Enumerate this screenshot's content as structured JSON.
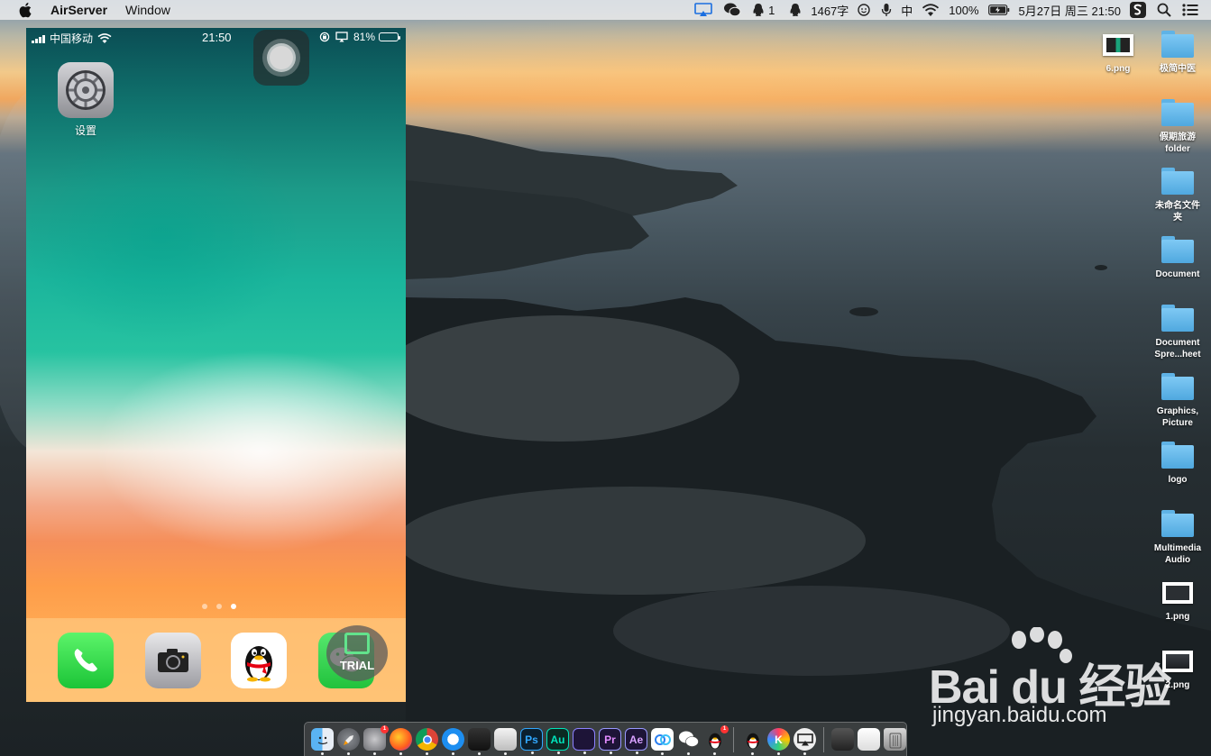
{
  "menubar": {
    "app_name": "AirServer",
    "menus": [
      "Window"
    ],
    "word_count": "1467字",
    "input_method": "中",
    "battery": "100%",
    "datetime": "5月27日 周三  21:50",
    "qq_count": "1"
  },
  "phone": {
    "status": {
      "carrier": "中国移动",
      "time": "21:50",
      "battery": "81%",
      "battery_level": 0.81
    },
    "home_apps": [
      {
        "label": "设置",
        "icon": "settings-gear-icon"
      }
    ],
    "page_count": 3,
    "active_page": 3,
    "dock_apps": [
      {
        "icon": "phone-icon"
      },
      {
        "icon": "camera-icon"
      },
      {
        "icon": "qq-penguin-icon"
      },
      {
        "icon": "wechat-icon"
      }
    ],
    "trial_label": "TRIAL"
  },
  "desktop": {
    "icons": [
      {
        "label": "6.png",
        "type": "image"
      },
      {
        "label": "极简中医",
        "type": "folder"
      },
      {
        "label": "假期旅游\nfolder",
        "type": "folder"
      },
      {
        "label": "未命名文件\n夹",
        "type": "folder"
      },
      {
        "label": "Document",
        "type": "folder"
      },
      {
        "label": "Document\nSpre...heet",
        "type": "folder"
      },
      {
        "label": "Graphics,\nPicture",
        "type": "folder"
      },
      {
        "label": "logo",
        "type": "folder"
      },
      {
        "label": "Multimedia\nAudio",
        "type": "folder"
      },
      {
        "label": "1.png",
        "type": "image"
      },
      {
        "label": "2.png",
        "type": "image"
      }
    ]
  },
  "dock": {
    "apps": [
      {
        "icon": "finder-icon",
        "text": ""
      },
      {
        "icon": "launchpad-rocket-icon",
        "text": ""
      },
      {
        "icon": "system-preferences-icon",
        "text": "",
        "badge": "1"
      },
      {
        "icon": "firefox-icon",
        "text": ""
      },
      {
        "icon": "chrome-icon",
        "text": ""
      },
      {
        "icon": "quicktime-icon",
        "text": ""
      },
      {
        "icon": "final-cut-icon",
        "text": ""
      },
      {
        "icon": "screenshot-icon",
        "text": ""
      },
      {
        "icon": "photoshop-icon",
        "text": "Ps"
      },
      {
        "icon": "audition-icon",
        "text": "Au"
      },
      {
        "icon": "media-encoder-icon",
        "text": ""
      },
      {
        "icon": "premiere-icon",
        "text": "Pr"
      },
      {
        "icon": "after-effects-icon",
        "text": "Ae"
      },
      {
        "icon": "baidu-netdisk-icon",
        "text": ""
      },
      {
        "icon": "wechat-dock-icon",
        "text": ""
      },
      {
        "icon": "qq-dock-icon",
        "text": "",
        "badge": "1"
      }
    ],
    "apps2": [
      {
        "icon": "qq-alt-icon",
        "text": ""
      },
      {
        "icon": "kuaiying-icon",
        "text": "K"
      },
      {
        "icon": "airserver-icon",
        "text": ""
      }
    ],
    "stacks": [
      {
        "icon": "stack-window-icon"
      },
      {
        "icon": "stack-screenshot-icon"
      },
      {
        "icon": "trash-icon"
      }
    ]
  },
  "watermark": {
    "brand": "Bai du 经验",
    "url": "jingyan.baidu.com"
  }
}
